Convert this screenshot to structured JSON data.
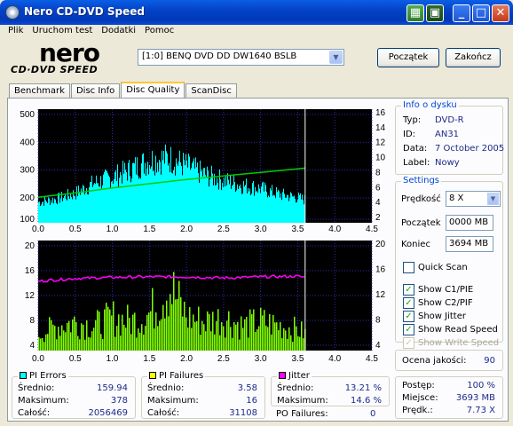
{
  "window": {
    "title": "Nero CD-DVD Speed"
  },
  "menu": [
    "Plik",
    "Uruchom test",
    "Dodatki",
    "Pomoc"
  ],
  "logo": {
    "brand": "nero",
    "product": "CD·DVD SPEED"
  },
  "drive": {
    "selected": "[1:0]   BENQ DVD DD DW1640 BSLB"
  },
  "buttons": {
    "start": "Początek",
    "exit": "Zakończ"
  },
  "tabs": [
    "Benchmark",
    "Disc Info",
    "Disc Quality",
    "ScanDisc"
  ],
  "active_tab": "Disc Quality",
  "disc_info": {
    "title": "Info o dysku",
    "rows": [
      {
        "label": "Typ:",
        "value": "DVD-R"
      },
      {
        "label": "ID:",
        "value": "AN31"
      },
      {
        "label": "Data:",
        "value": "7 October 2005"
      },
      {
        "label": "Label:",
        "value": "Nowy"
      }
    ]
  },
  "settings": {
    "title": "Settings",
    "speed_label": "Prędkość",
    "speed_value": "8 X",
    "start_label": "Początek",
    "start_value": "0000 MB",
    "end_label": "Koniec",
    "end_value": "3694 MB",
    "quick_scan": "Quick Scan",
    "checks": [
      {
        "label": "Show C1/PIE",
        "checked": true,
        "disabled": false
      },
      {
        "label": "Show C2/PIF",
        "checked": true,
        "disabled": false
      },
      {
        "label": "Show Jitter",
        "checked": true,
        "disabled": false
      },
      {
        "label": "Show Read Speed",
        "checked": true,
        "disabled": false
      },
      {
        "label": "Show Write Speed",
        "checked": true,
        "disabled": true
      }
    ]
  },
  "quality": {
    "label": "Ocena jakości:",
    "value": "90"
  },
  "progress": {
    "rows": [
      {
        "label": "Postęp:",
        "value": "100 %"
      },
      {
        "label": "Miejsce:",
        "value": "3693 MB"
      },
      {
        "label": "Prędk.:",
        "value": "7.73 X"
      }
    ]
  },
  "stats": {
    "pi_errors": {
      "title": "PI Errors",
      "color": "#00ffff",
      "rows": [
        [
          "Średnio:",
          "159.94"
        ],
        [
          "Maksimum:",
          "378"
        ],
        [
          "Całość:",
          "2056469"
        ]
      ]
    },
    "pi_failures": {
      "title": "PI Failures",
      "color": "#ffff00",
      "rows": [
        [
          "Średnio:",
          "3.58"
        ],
        [
          "Maksimum:",
          "16"
        ],
        [
          "Całość:",
          "31108"
        ]
      ]
    },
    "jitter": {
      "title": "Jitter",
      "color": "#ff00ff",
      "rows": [
        [
          "Średnio:",
          "13.21 %"
        ],
        [
          "Maksimum:",
          "14.6 %"
        ]
      ]
    },
    "po_failures": {
      "label": "PO Failures:",
      "value": "0"
    }
  },
  "chart_data": [
    {
      "type": "area",
      "name": "PI Errors / Read Speed",
      "x_ticks": [
        "0.0",
        "0.5",
        "1.0",
        "1.5",
        "2.0",
        "2.5",
        "3.0",
        "3.5",
        "4.0",
        "4.5"
      ],
      "y_left_ticks": [
        "500",
        "400",
        "300",
        "200",
        "100"
      ],
      "y_right_ticks": [
        "16",
        "14",
        "12",
        "10",
        "8",
        "6",
        "4",
        "2"
      ],
      "xlim": [
        0,
        4.5
      ],
      "ylim_left": [
        0,
        500
      ],
      "ylim_right": [
        0,
        16
      ],
      "end_marker_x": 3.6,
      "series": [
        {
          "name": "PI Errors",
          "color": "#00ffff",
          "x": [
            0.0,
            0.25,
            0.5,
            0.75,
            1.0,
            1.25,
            1.5,
            1.75,
            2.0,
            2.25,
            2.5,
            2.75,
            3.0,
            3.25,
            3.5,
            3.6
          ],
          "values": [
            90,
            105,
            130,
            175,
            200,
            235,
            275,
            285,
            250,
            210,
            185,
            165,
            150,
            125,
            110,
            100
          ]
        },
        {
          "name": "Read Speed",
          "color": "#00cc00",
          "x": [
            0.0,
            0.5,
            1.0,
            1.5,
            2.0,
            2.5,
            3.0,
            3.5,
            3.6
          ],
          "values": [
            3.6,
            4.2,
            4.9,
            5.5,
            6.1,
            6.6,
            7.1,
            7.6,
            7.7
          ]
        }
      ]
    },
    {
      "type": "bar",
      "name": "PI Failures / Jitter",
      "x_ticks": [
        "0.0",
        "0.5",
        "1.0",
        "1.5",
        "2.0",
        "2.5",
        "3.0",
        "3.5",
        "4.0",
        "4.5"
      ],
      "y_left_ticks": [
        "20",
        "16",
        "12",
        "8",
        "4"
      ],
      "y_right_ticks": [
        "20",
        "16",
        "12",
        "8",
        "4"
      ],
      "xlim": [
        0,
        4.5
      ],
      "ylim": [
        0,
        20
      ],
      "end_marker_x": 3.6,
      "series": [
        {
          "name": "PI Failures",
          "color": "#80ff00",
          "x": [
            0.0,
            0.25,
            0.5,
            0.75,
            1.0,
            1.25,
            1.5,
            1.75,
            2.0,
            2.25,
            2.5,
            2.75,
            3.0,
            3.25,
            3.5,
            3.6
          ],
          "values": [
            4,
            6,
            7,
            6,
            8,
            7,
            9,
            16,
            8,
            7,
            8,
            6,
            7,
            6,
            5,
            4
          ]
        },
        {
          "name": "Jitter",
          "color": "#ff00ff",
          "x": [
            0.0,
            0.5,
            1.0,
            1.5,
            2.0,
            2.5,
            3.0,
            3.5,
            3.6
          ],
          "values": [
            12.6,
            13.1,
            13.3,
            13.4,
            13.4,
            13.2,
            13.4,
            13.5,
            13.3
          ]
        }
      ]
    }
  ]
}
